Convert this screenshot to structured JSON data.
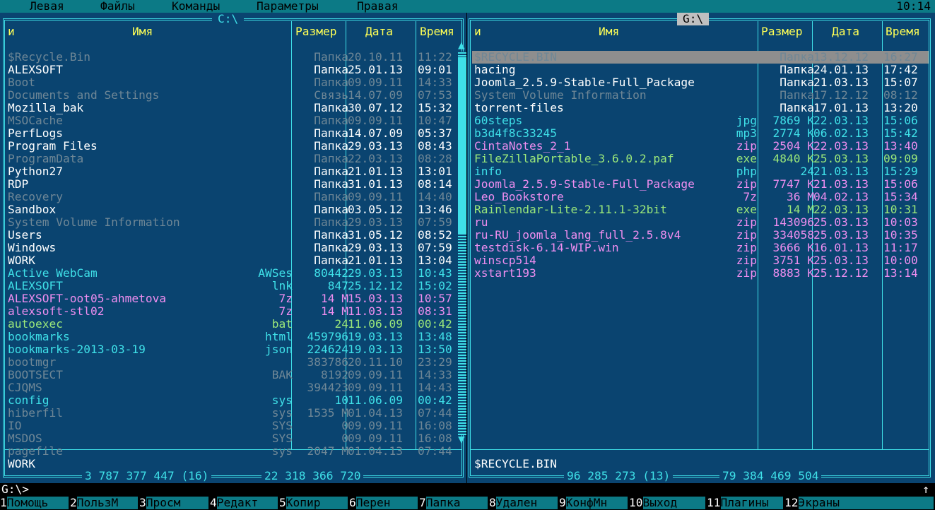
{
  "menu": {
    "items": [
      "Левая",
      "Файлы",
      "Команды",
      "Параметры",
      "Правая"
    ],
    "clock": "10:14"
  },
  "left": {
    "path": "C:\\",
    "headers": {
      "n": "и",
      "name": "Имя",
      "size": "Размер",
      "date": "Дата",
      "time": "Время"
    },
    "rows": [
      {
        "name": "$Recycle.Bin",
        "ext": "",
        "size": "Папка",
        "date": "20.10.11",
        "time": "11:22",
        "kind": "hid"
      },
      {
        "name": "ALEXSOFT",
        "ext": "",
        "size": "Папка",
        "date": "25.01.13",
        "time": "09:01",
        "kind": "dir"
      },
      {
        "name": "Boot",
        "ext": "",
        "size": "Папка",
        "date": "09.09.11",
        "time": "14:33",
        "kind": "hid"
      },
      {
        "name": "Documents and Settings",
        "ext": "",
        "size": "Связь",
        "date": "14.07.09",
        "time": "07:53",
        "kind": "hid"
      },
      {
        "name": "Mozilla_bak",
        "ext": "",
        "size": "Папка",
        "date": "30.07.12",
        "time": "15:32",
        "kind": "dir"
      },
      {
        "name": "MSOCache",
        "ext": "",
        "size": "Папка",
        "date": "09.09.11",
        "time": "10:47",
        "kind": "hid"
      },
      {
        "name": "PerfLogs",
        "ext": "",
        "size": "Папка",
        "date": "14.07.09",
        "time": "05:37",
        "kind": "dir"
      },
      {
        "name": "Program Files",
        "ext": "",
        "size": "Папка",
        "date": "29.03.13",
        "time": "08:43",
        "kind": "dir"
      },
      {
        "name": "ProgramData",
        "ext": "",
        "size": "Папка",
        "date": "22.03.13",
        "time": "08:28",
        "kind": "hid"
      },
      {
        "name": "Python27",
        "ext": "",
        "size": "Папка",
        "date": "21.01.13",
        "time": "13:01",
        "kind": "dir"
      },
      {
        "name": "RDP",
        "ext": "",
        "size": "Папка",
        "date": "31.01.13",
        "time": "08:14",
        "kind": "dir"
      },
      {
        "name": "Recovery",
        "ext": "",
        "size": "Папка",
        "date": "09.09.11",
        "time": "14:40",
        "kind": "hid"
      },
      {
        "name": "Sandbox",
        "ext": "",
        "size": "Папка",
        "date": "03.05.12",
        "time": "13:46",
        "kind": "dir"
      },
      {
        "name": "System Volume Information",
        "ext": "",
        "size": "Папка",
        "date": "29.03.13",
        "time": "07:59",
        "kind": "hid"
      },
      {
        "name": "Users",
        "ext": "",
        "size": "Папка",
        "date": "31.05.12",
        "time": "08:52",
        "kind": "dir"
      },
      {
        "name": "Windows",
        "ext": "",
        "size": "Папка",
        "date": "29.03.13",
        "time": "07:59",
        "kind": "dir"
      },
      {
        "name": "WORK",
        "ext": "",
        "size": "Папка",
        "date": "21.01.13",
        "time": "13:04",
        "kind": "dir"
      },
      {
        "name": "Active WebCam",
        "ext": "AWSes",
        "size": "80442",
        "date": "29.03.13",
        "time": "10:43",
        "kind": "file"
      },
      {
        "name": "ALEXSOFT",
        "ext": "lnk",
        "size": "847",
        "date": "25.12.12",
        "time": "15:02",
        "kind": "lnk"
      },
      {
        "name": "ALEXSOFT-oot05-ahmetova",
        "ext": "7z",
        "size": "14 M",
        "date": "15.03.13",
        "time": "10:57",
        "kind": "arc"
      },
      {
        "name": "alexsoft-stl02",
        "ext": "7z",
        "size": "14 M",
        "date": "11.03.13",
        "time": "08:31",
        "kind": "arc"
      },
      {
        "name": "autoexec",
        "ext": "bat",
        "size": "24",
        "date": "11.06.09",
        "time": "00:42",
        "kind": "bat"
      },
      {
        "name": "bookmarks",
        "ext": "html",
        "size": "459796",
        "date": "19.03.13",
        "time": "13:48",
        "kind": "file"
      },
      {
        "name": "bookmarks-2013-03-19",
        "ext": "json",
        "size": "224624",
        "date": "19.03.13",
        "time": "13:50",
        "kind": "file"
      },
      {
        "name": "bootmgr",
        "ext": "",
        "size": "383786",
        "date": "20.11.10",
        "time": "23:29",
        "kind": "hid"
      },
      {
        "name": "BOOTSECT",
        "ext": "BAK",
        "size": "8192",
        "date": "09.09.11",
        "time": "14:33",
        "kind": "hid"
      },
      {
        "name": "CJQMS",
        "ext": "",
        "size": "394423",
        "date": "09.09.11",
        "time": "14:43",
        "kind": "hid"
      },
      {
        "name": "config",
        "ext": "sys",
        "size": "10",
        "date": "11.06.09",
        "time": "00:42",
        "kind": "file"
      },
      {
        "name": "hiberfil",
        "ext": "sys",
        "size": "1535 M",
        "date": "01.04.13",
        "time": "07:44",
        "kind": "hid"
      },
      {
        "name": "IO",
        "ext": "SYS",
        "size": "0",
        "date": "09.09.11",
        "time": "16:08",
        "kind": "hid"
      },
      {
        "name": "MSDOS",
        "ext": "SYS",
        "size": "0",
        "date": "09.09.11",
        "time": "16:08",
        "kind": "hid"
      },
      {
        "name": "pagefile",
        "ext": "sys",
        "size": "2047 M",
        "date": "01.04.13",
        "time": "07:44",
        "kind": "hid"
      }
    ],
    "status": "WORK",
    "totals": "3 787 377 447 (16)",
    "free": "22 318 366 720"
  },
  "right": {
    "path": "G:\\",
    "headers": {
      "n": "и",
      "name": "Имя",
      "size": "Размер",
      "date": "Дата",
      "time": "Время"
    },
    "rows": [
      {
        "name": "$RECYCLE.BIN",
        "ext": "",
        "size": "Папка",
        "date": "13.12.12",
        "time": "16:27",
        "kind": "hid",
        "selected": true
      },
      {
        "name": "hacing",
        "ext": "",
        "size": "Папка",
        "date": "24.01.13",
        "time": "17:42",
        "kind": "dir"
      },
      {
        "name": "Joomla_2.5.9-Stable-Full_Package",
        "ext": "",
        "size": "Папка",
        "date": "21.03.13",
        "time": "15:07",
        "kind": "dir"
      },
      {
        "name": "System Volume Information",
        "ext": "",
        "size": "Папка",
        "date": "17.12.12",
        "time": "08:12",
        "kind": "hid"
      },
      {
        "name": "torrent-files",
        "ext": "",
        "size": "Папка",
        "date": "17.01.13",
        "time": "13:20",
        "kind": "dir"
      },
      {
        "name": "60steps",
        "ext": "jpg",
        "size": "7869 K",
        "date": "22.03.13",
        "time": "15:06",
        "kind": "file"
      },
      {
        "name": "b3d4f8c33245",
        "ext": "mp3",
        "size": "2774 K",
        "date": "06.02.13",
        "time": "15:42",
        "kind": "file"
      },
      {
        "name": "CintaNotes_2_1",
        "ext": "zip",
        "size": "2504 K",
        "date": "22.03.13",
        "time": "13:40",
        "kind": "arc"
      },
      {
        "name": "FileZillaPortable_3.6.0.2.paf",
        "ext": "exe",
        "size": "4840 K",
        "date": "25.03.13",
        "time": "09:09",
        "kind": "bat"
      },
      {
        "name": "info",
        "ext": "php",
        "size": "24",
        "date": "21.03.13",
        "time": "15:29",
        "kind": "file"
      },
      {
        "name": "Joomla_2.5.9-Stable-Full_Package",
        "ext": "zip",
        "size": "7747 K",
        "date": "21.03.13",
        "time": "15:06",
        "kind": "arc"
      },
      {
        "name": "Leo_Bookstore",
        "ext": "7z",
        "size": "36 M",
        "date": "04.02.13",
        "time": "15:34",
        "kind": "arc"
      },
      {
        "name": "Rainlendar-Lite-2.11.1-32bit",
        "ext": "exe",
        "size": "14 M",
        "date": "22.03.13",
        "time": "10:31",
        "kind": "bat"
      },
      {
        "name": "ru",
        "ext": "zip",
        "size": "143096",
        "date": "25.03.13",
        "time": "10:03",
        "kind": "arc"
      },
      {
        "name": "ru-RU_joomla_lang_full_2.5.8v4",
        "ext": "zip",
        "size": "334058",
        "date": "25.03.13",
        "time": "10:35",
        "kind": "arc"
      },
      {
        "name": "testdisk-6.14-WIP.win",
        "ext": "zip",
        "size": "3666 K",
        "date": "16.01.13",
        "time": "11:17",
        "kind": "arc"
      },
      {
        "name": "winscp514",
        "ext": "zip",
        "size": "3751 K",
        "date": "25.03.13",
        "time": "10:00",
        "kind": "arc"
      },
      {
        "name": "xstart193",
        "ext": "zip",
        "size": "8883 K",
        "date": "25.12.12",
        "time": "13:14",
        "kind": "arc"
      }
    ],
    "status": "$RECYCLE.BIN",
    "totals": "96 285 273 (13)",
    "free": "79 384 469 504"
  },
  "cmdline": {
    "prompt": "G:\\>",
    "scroll_marker": "↑"
  },
  "keybar": [
    {
      "n": "1",
      "label": "Помощь"
    },
    {
      "n": "2",
      "label": "ПользМ"
    },
    {
      "n": "3",
      "label": "Просм"
    },
    {
      "n": "4",
      "label": "Редакт"
    },
    {
      "n": "5",
      "label": "Копир"
    },
    {
      "n": "6",
      "label": "Перен"
    },
    {
      "n": "7",
      "label": "Папка"
    },
    {
      "n": "8",
      "label": "Удален"
    },
    {
      "n": "9",
      "label": "КонфМн"
    },
    {
      "n": "10",
      "label": "Выход"
    },
    {
      "n": "11",
      "label": "Плагины"
    },
    {
      "n": "12",
      "label": "Экраны"
    }
  ],
  "colors": {
    "panel_bg": "#0a4470",
    "frame": "#3fe0e8",
    "header": "#ffff55",
    "selection": "#8e8e8e"
  }
}
